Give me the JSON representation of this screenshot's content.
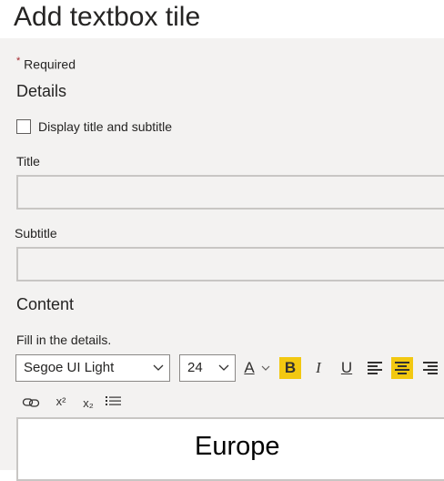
{
  "header": {
    "title": "Add textbox tile"
  },
  "form": {
    "required_star": "*",
    "required_label": "Required",
    "details_heading": "Details",
    "display_checkbox_label": "Display title and subtitle",
    "display_checked": false,
    "title_label": "Title",
    "title_value": "",
    "subtitle_label": "Subtitle",
    "subtitle_value": "",
    "content_heading": "Content",
    "fill_label": "Fill in the details."
  },
  "toolbar": {
    "font_family": "Segoe UI Light",
    "font_size": "24",
    "font_color_glyph": "A",
    "bold_glyph": "B",
    "italic_glyph": "I",
    "underline_glyph": "U",
    "superscript_glyph": "x²",
    "subscript_glyph": "x₂",
    "bold_active": true,
    "align_center_active": true,
    "accent_color": "#f2c811",
    "icons": [
      "chevron-down-icon",
      "font-color-icon",
      "bold-icon",
      "italic-icon",
      "underline-icon",
      "align-left-icon",
      "align-center-icon",
      "align-right-icon",
      "link-icon",
      "superscript-icon",
      "subscript-icon",
      "list-icon"
    ]
  },
  "editor": {
    "text": "Europe"
  }
}
